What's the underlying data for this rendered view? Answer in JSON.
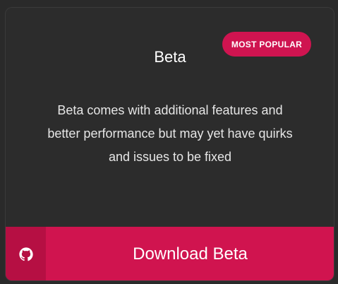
{
  "card": {
    "badge": "MOST POPULAR",
    "title": "Beta",
    "description_lines": [
      "Beta comes with additional features and",
      "better performance but may yet have quirks",
      "and issues to be fixed"
    ],
    "button_label": "Download Beta",
    "button_icon": "github-icon"
  },
  "colors": {
    "accent": "#d0144f",
    "accent_dark": "#b60f43",
    "card_bg": "#2c2c2c"
  }
}
